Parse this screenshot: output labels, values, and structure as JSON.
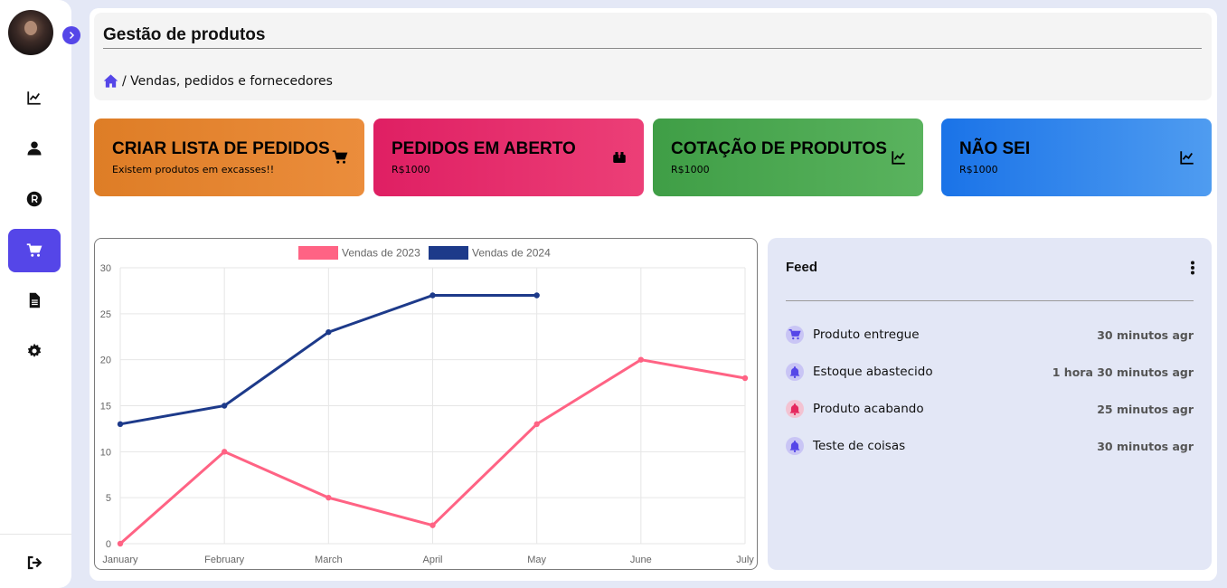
{
  "app": {
    "title": "Gestão de produtos"
  },
  "breadcrumb": {
    "path": "/ Vendas, pedidos e fornecedores"
  },
  "cards": [
    {
      "title": "CRIAR LISTA DE PEDIDOS",
      "subtitle": "Existem produtos em excasses!!",
      "icon": "cart-icon",
      "color": "#e5842f"
    },
    {
      "title": "PEDIDOS EM ABERTO",
      "subtitle": "R$1000",
      "icon": "box-icon",
      "color": "#e52d6c"
    },
    {
      "title": "COTAÇÃO DE PRODUTOS",
      "subtitle": "R$1000",
      "icon": "chart-line-icon",
      "color": "#4ba951"
    },
    {
      "title": "NÃO SEI",
      "subtitle": "R$1000",
      "icon": "chart-line-icon",
      "color": "#2f86ec"
    }
  ],
  "sidebar": {
    "items": [
      "chart-line-icon",
      "user-icon",
      "registered-icon",
      "cart-icon",
      "document-icon",
      "gear-icon"
    ],
    "active_index": 3,
    "accent": "#5546e8",
    "logout_icon": "logout-icon"
  },
  "chart_data": {
    "type": "line",
    "categories": [
      "January",
      "February",
      "March",
      "April",
      "May",
      "June",
      "July"
    ],
    "ylim": [
      0,
      30
    ],
    "yticks": [
      0,
      5,
      10,
      15,
      20,
      25,
      30
    ],
    "grid": true,
    "legend": "top-center",
    "series": [
      {
        "name": "Vendas de 2023",
        "color": "#ff6384",
        "values": [
          0,
          10,
          5,
          2,
          13,
          20,
          18
        ]
      },
      {
        "name": "Vendas de 2024",
        "color": "#1d3a8a",
        "values": [
          13,
          15,
          23,
          27,
          27,
          null,
          null
        ]
      }
    ]
  },
  "feed": {
    "title": "Feed",
    "items": [
      {
        "text": "Produto entregue",
        "time": "30 minutos agr",
        "icon": "cart-icon",
        "icon_color": "#5546e8",
        "bg": "#c9c5f5"
      },
      {
        "text": "Estoque abastecido",
        "time": "1 hora 30 minutos agr",
        "icon": "bell-icon",
        "icon_color": "#5546e8",
        "bg": "#c9c5f5"
      },
      {
        "text": "Produto acabando",
        "time": "25 minutos agr",
        "icon": "bell-icon",
        "icon_color": "#e5295f",
        "bg": "#f3c3d2"
      },
      {
        "text": "Teste de coisas",
        "time": "30 minutos agr",
        "icon": "bell-icon",
        "icon_color": "#5546e8",
        "bg": "#c9c5f5"
      }
    ]
  }
}
